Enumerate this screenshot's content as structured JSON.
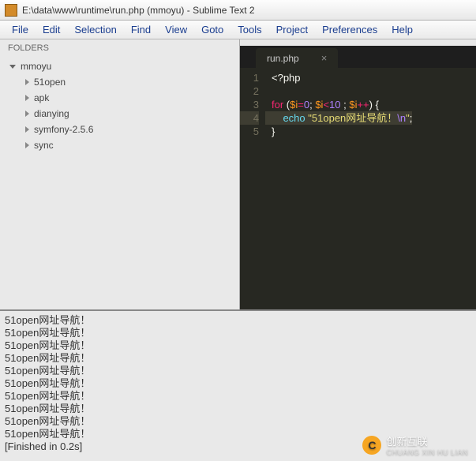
{
  "window": {
    "title": "E:\\data\\www\\runtime\\run.php (mmoyu) - Sublime Text 2"
  },
  "menu": {
    "file": "File",
    "edit": "Edit",
    "selection": "Selection",
    "find": "Find",
    "view": "View",
    "goto": "Goto",
    "tools": "Tools",
    "project": "Project",
    "preferences": "Preferences",
    "help": "Help"
  },
  "sidebar": {
    "title": "FOLDERS",
    "root": "mmoyu",
    "children": [
      "51open",
      "apk",
      "dianying",
      "symfony-2.5.6",
      "sync"
    ]
  },
  "tab": {
    "name": "run.php",
    "close": "×"
  },
  "code": {
    "line1": "<?php",
    "line3_kw": "for",
    "line3_var1": "$i",
    "line3_num0": "0",
    "line3_var2": "$i",
    "line3_op_lt": "<",
    "line3_num10": "10",
    "line3_var3": "$i",
    "line3_op_inc": "++",
    "line4_func": "echo",
    "line4_str1": "\"51open网址导航！",
    "line4_esc": "\\n",
    "line4_str2": "\""
  },
  "gutter": [
    "1",
    "2",
    "3",
    "4",
    "5"
  ],
  "console": {
    "lines": [
      "51open网址导航！",
      "51open网址导航！",
      "51open网址导航！",
      "51open网址导航！",
      "51open网址导航！",
      "51open网址导航！",
      "51open网址导航！",
      "51open网址导航！",
      "51open网址导航！",
      "51open网址导航！"
    ],
    "finished": "[Finished in 0.2s]"
  },
  "watermark": {
    "brand": "创新互联",
    "sub": "CHUANG XIN HU LIAN",
    "logo": "C"
  }
}
